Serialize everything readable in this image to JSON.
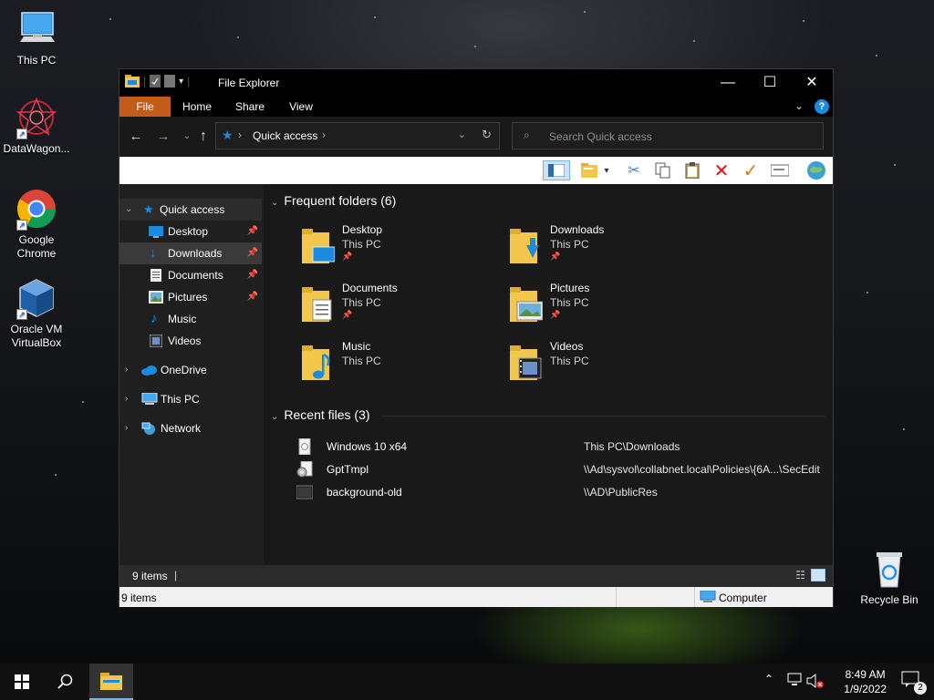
{
  "desktop": {
    "icons": [
      {
        "label": "This PC"
      },
      {
        "label": "DataWagon..."
      },
      {
        "label": "Google Chrome"
      },
      {
        "label": "Oracle VM VirtualBox"
      },
      {
        "label": "Recycle Bin"
      }
    ]
  },
  "window": {
    "title": "File Explorer",
    "ribbon_tabs": [
      "File",
      "Home",
      "Share",
      "View"
    ],
    "address": {
      "location": "Quick access"
    },
    "search": {
      "placeholder": "Search Quick access"
    },
    "nav": {
      "quick_access": "Quick access",
      "pinned": [
        "Desktop",
        "Downloads",
        "Documents",
        "Pictures",
        "Music",
        "Videos"
      ],
      "onedrive": "OneDrive",
      "this_pc": "This PC",
      "network": "Network"
    },
    "frequent": {
      "heading": "Frequent folders (6)",
      "folders": [
        {
          "name": "Desktop",
          "location": "This PC"
        },
        {
          "name": "Downloads",
          "location": "This PC"
        },
        {
          "name": "Documents",
          "location": "This PC"
        },
        {
          "name": "Pictures",
          "location": "This PC"
        },
        {
          "name": "Music",
          "location": "This PC"
        },
        {
          "name": "Videos",
          "location": "This PC"
        }
      ]
    },
    "recent": {
      "heading": "Recent files (3)",
      "files": [
        {
          "name": "Windows 10 x64",
          "location": "This PC\\Downloads"
        },
        {
          "name": "GptTmpl",
          "location": "\\\\Ad\\sysvol\\collabnet.local\\Policies\\{6A...\\SecEdit"
        },
        {
          "name": "background-old",
          "location": "\\\\AD\\PublicRes"
        }
      ]
    },
    "status": {
      "items": "9 items",
      "items_light": "9 items",
      "zone": "Computer"
    }
  },
  "taskbar": {
    "time": "8:49 AM",
    "date": "1/9/2022",
    "notifications": "2"
  },
  "colors": {
    "file_tab": "#c35b1b",
    "accent": "#1a8ce0"
  }
}
